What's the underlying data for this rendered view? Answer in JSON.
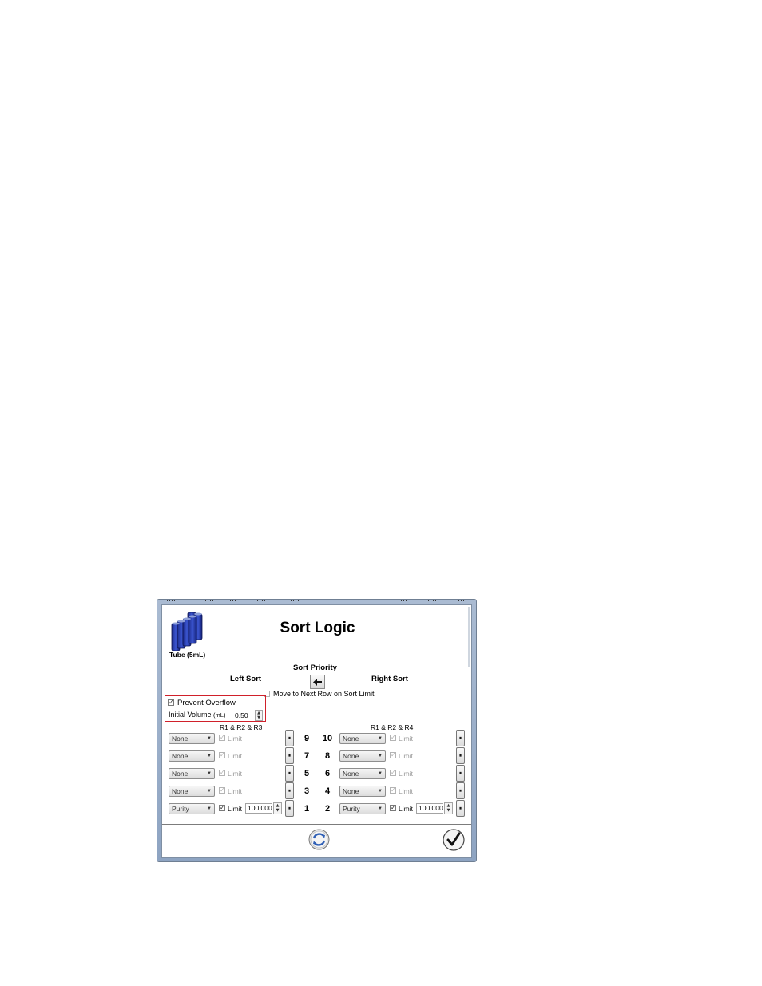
{
  "dialog": {
    "title": "Sort Logic",
    "tube_label": "Tube (5mL)",
    "sort_priority_label": "Sort Priority",
    "left_sort_label": "Left Sort",
    "right_sort_label": "Right Sort",
    "move_next_row_label": "Move to Next Row on Sort Limit",
    "move_next_row_checked": false,
    "prevent_overflow_label": "Prevent Overflow",
    "prevent_overflow_checked": true,
    "initial_volume_label": "Initial Volume",
    "initial_volume_unit": "(mL)",
    "initial_volume_value": "0.50",
    "left_gate_label": "R1 & R2 & R3",
    "right_gate_label": "R1 & R2 & R4",
    "limit_label": "Limit",
    "accent_color": "#d0202a"
  },
  "rows": [
    {
      "left_num": "9",
      "right_num": "10",
      "left_mode": "None",
      "right_mode": "None",
      "left_limit_checked": true,
      "right_limit_checked": true,
      "left_value": "",
      "right_value": ""
    },
    {
      "left_num": "7",
      "right_num": "8",
      "left_mode": "None",
      "right_mode": "None",
      "left_limit_checked": true,
      "right_limit_checked": true,
      "left_value": "",
      "right_value": ""
    },
    {
      "left_num": "5",
      "right_num": "6",
      "left_mode": "None",
      "right_mode": "None",
      "left_limit_checked": true,
      "right_limit_checked": true,
      "left_value": "",
      "right_value": ""
    },
    {
      "left_num": "3",
      "right_num": "4",
      "left_mode": "None",
      "right_mode": "None",
      "left_limit_checked": true,
      "right_limit_checked": true,
      "left_value": "",
      "right_value": ""
    },
    {
      "left_num": "1",
      "right_num": "2",
      "left_mode": "Purity",
      "right_mode": "Purity",
      "left_limit_checked": true,
      "right_limit_checked": true,
      "left_value": "100,000",
      "right_value": "100,000"
    }
  ],
  "icons": {
    "tube": "tube-rack-icon",
    "priority_arrow": "arrow-left-icon",
    "reset": "refresh-icon",
    "ok": "checkmark-icon",
    "pause": "pause-icon"
  }
}
